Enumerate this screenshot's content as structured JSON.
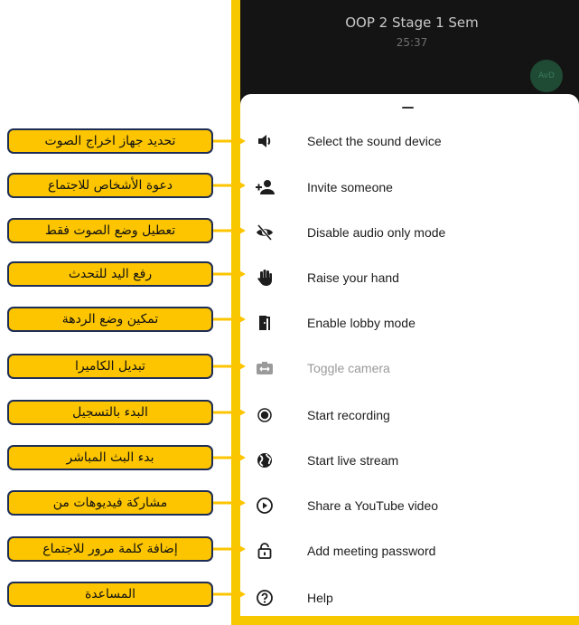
{
  "call": {
    "title": "OOP 2 Stage 1 Sem",
    "timer": "25:37",
    "avatar_initials": "AvD"
  },
  "menu": {
    "items": [
      {
        "label": "Select the sound device",
        "icon": "speaker-icon",
        "disabled": false
      },
      {
        "label": "Invite someone",
        "icon": "add-person-icon",
        "disabled": false
      },
      {
        "label": "Disable audio only mode",
        "icon": "eye-off-icon",
        "disabled": false
      },
      {
        "label": "Raise your hand",
        "icon": "hand-icon",
        "disabled": false
      },
      {
        "label": "Enable lobby mode",
        "icon": "door-icon",
        "disabled": false
      },
      {
        "label": "Toggle camera",
        "icon": "camera-switch-icon",
        "disabled": true
      },
      {
        "label": "Start recording",
        "icon": "record-icon",
        "disabled": false
      },
      {
        "label": "Start live stream",
        "icon": "globe-icon",
        "disabled": false
      },
      {
        "label": "Share a YouTube video",
        "icon": "play-circle-icon",
        "disabled": false
      },
      {
        "label": "Add meeting password",
        "icon": "lock-icon",
        "disabled": false
      },
      {
        "label": "Help",
        "icon": "help-icon",
        "disabled": false
      }
    ]
  },
  "annotations": [
    "تحديد جهاز اخراج الصوت",
    "دعوة الأشخاص للاجتماع",
    "تعطيل وضع الصوت فقط",
    "رفع اليد للتحدث",
    "تمكين وضع الردهة",
    "تبديل الكاميرا",
    "البدء بالتسجيل",
    "بدء البث المباشر",
    "مشاركة فيديوهات من",
    "إضافة كلمة مرور للاجتماع",
    "المساعدة"
  ],
  "colors": {
    "frame": "#f7c700",
    "callout_bg": "#fcc500",
    "callout_border": "#1e2d55",
    "screen_bg": "#141414"
  }
}
